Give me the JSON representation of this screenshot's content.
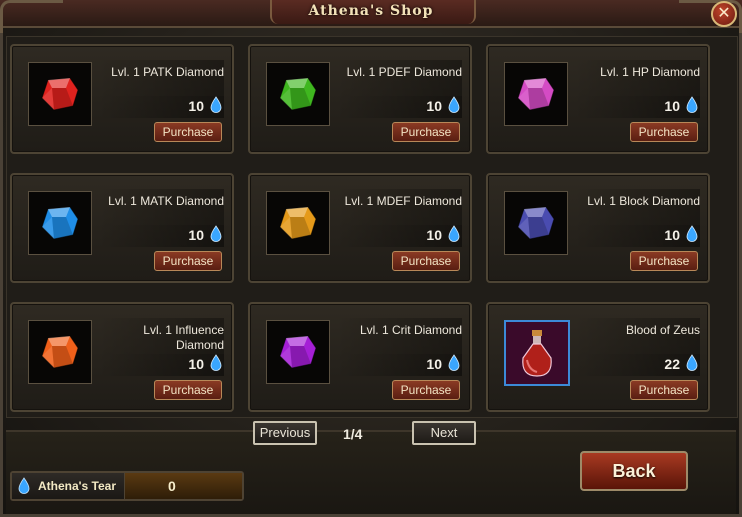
{
  "window": {
    "title": "Athena's Shop",
    "close_label": "✕"
  },
  "items": [
    {
      "name": "Lvl. 1 PATK Diamond",
      "price": "10",
      "purchase_label": "Purchase",
      "icon": "red-gem-icon",
      "color": "#e0221e"
    },
    {
      "name": "Lvl. 1 PDEF Diamond",
      "price": "10",
      "purchase_label": "Purchase",
      "icon": "green-gem-icon",
      "color": "#3fb71f"
    },
    {
      "name": "Lvl. 1 HP Diamond",
      "price": "10",
      "purchase_label": "Purchase",
      "icon": "pink-gem-icon",
      "color": "#d44bc4"
    },
    {
      "name": "Lvl. 1 MATK Diamond",
      "price": "10",
      "purchase_label": "Purchase",
      "icon": "blue-gem-icon",
      "color": "#1f8ee8"
    },
    {
      "name": "Lvl. 1 MDEF Diamond",
      "price": "10",
      "purchase_label": "Purchase",
      "icon": "orange-gem-icon",
      "color": "#e59a1a"
    },
    {
      "name": "Lvl. 1 Block Diamond",
      "price": "10",
      "purchase_label": "Purchase",
      "icon": "indigo-gem-icon",
      "color": "#4a4cb0"
    },
    {
      "name": "Lvl. 1 Influence Diamond",
      "price": "10",
      "purchase_label": "Purchase",
      "icon": "orange-red-gem-icon",
      "color": "#f0601a"
    },
    {
      "name": "Lvl. 1 Crit Diamond",
      "price": "10",
      "purchase_label": "Purchase",
      "icon": "purple-gem-icon",
      "color": "#a51fd6"
    },
    {
      "name": "Blood of Zeus",
      "price": "22",
      "purchase_label": "Purchase",
      "icon": "potion-bottle-icon",
      "color": "#b0201a"
    }
  ],
  "pagination": {
    "previous_label": "Previous",
    "page_indicator": "1/4",
    "next_label": "Next"
  },
  "currency": {
    "label": "Athena's Tear",
    "value": "0",
    "icon": "water-drop-icon"
  },
  "back_label": "Back",
  "colors": {
    "drop": "#3aa6ff",
    "accent": "#f3e2b8"
  }
}
